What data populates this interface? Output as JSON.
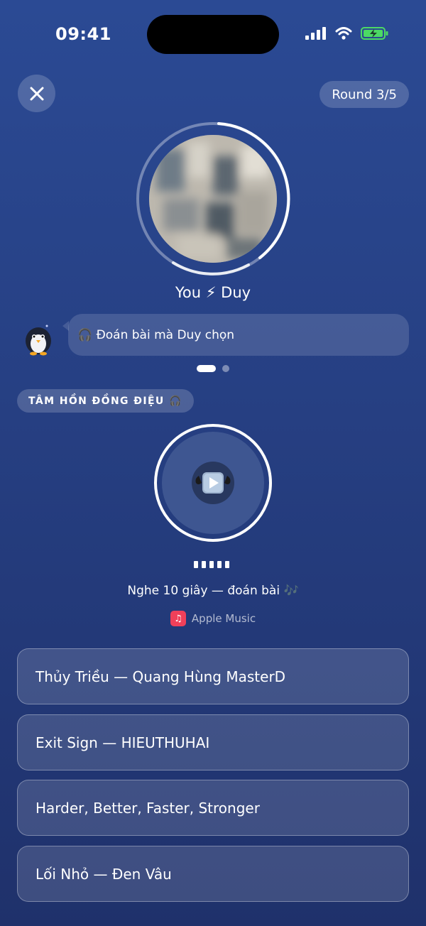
{
  "status_bar": {
    "time": "09:41"
  },
  "header": {
    "round_label": "Round 3/5"
  },
  "match": {
    "title": "You ⚡ Duy"
  },
  "hint": {
    "icon": "headphones-icon",
    "text": "🎧 Đoán bài mà Duy chọn"
  },
  "category": {
    "label": "TÂM HỒN ĐỒNG ĐIỆU 🎧"
  },
  "player": {
    "icon": "play-icon"
  },
  "instructions": {
    "text": "Nghe 10 giây — đoán bài 🎶"
  },
  "source": {
    "label": "Apple Music",
    "icon": "apple-music-icon",
    "color": "#f0405a"
  },
  "answers": [
    {
      "label": "Thủy Triều — Quang Hùng MasterD"
    },
    {
      "label": "Exit Sign — HIEUTHUHAI"
    },
    {
      "label": "Harder, Better, Faster, Stronger"
    },
    {
      "label": "Lối Nhỏ — Đen Vâu"
    }
  ],
  "colors": {
    "background_top": "#2b4a94",
    "background_bottom": "#1f316b",
    "battery": "#4cd964"
  }
}
